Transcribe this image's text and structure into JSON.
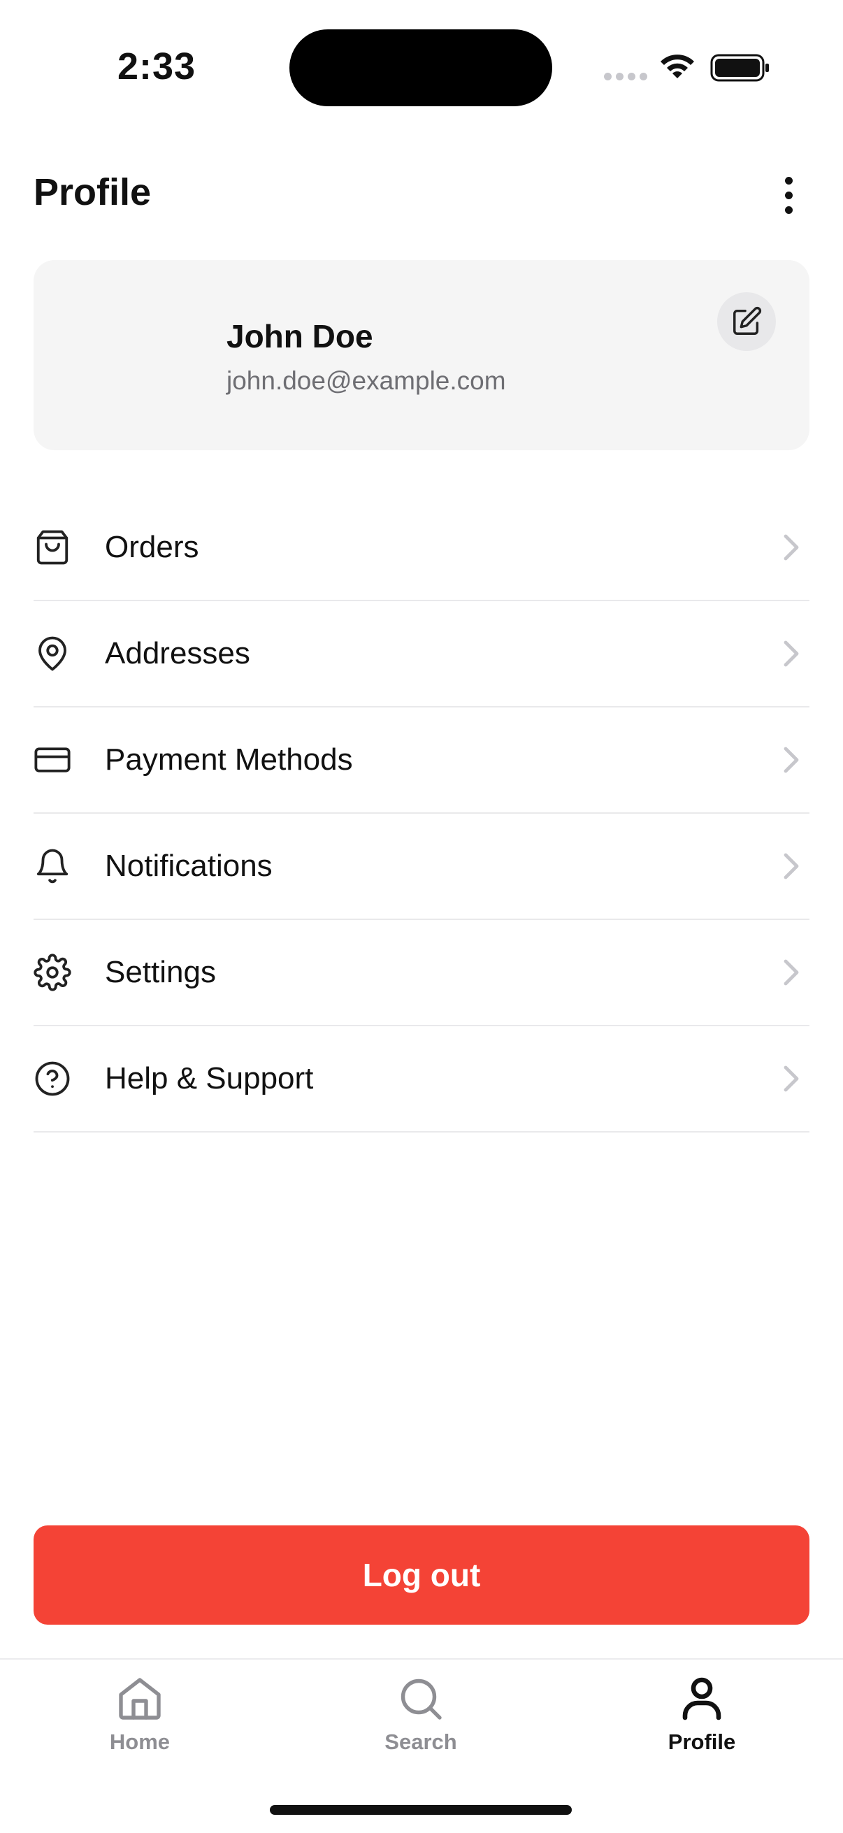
{
  "status_bar": {
    "time": "2:33"
  },
  "header": {
    "title": "Profile"
  },
  "profile": {
    "name": "John Doe",
    "email": "john.doe@example.com"
  },
  "menu": {
    "items": [
      {
        "label": "Orders",
        "icon": "shopping-bag-icon"
      },
      {
        "label": "Addresses",
        "icon": "map-pin-icon"
      },
      {
        "label": "Payment Methods",
        "icon": "credit-card-icon"
      },
      {
        "label": "Notifications",
        "icon": "bell-icon"
      },
      {
        "label": "Settings",
        "icon": "gear-icon"
      },
      {
        "label": "Help & Support",
        "icon": "help-circle-icon"
      }
    ]
  },
  "logout": {
    "label": "Log out",
    "color": "#f44336"
  },
  "tab_bar": {
    "tabs": [
      {
        "label": "Home",
        "icon": "home-icon",
        "active": false
      },
      {
        "label": "Search",
        "icon": "search-icon",
        "active": false
      },
      {
        "label": "Profile",
        "icon": "user-icon",
        "active": true
      }
    ],
    "active_color": "#111111",
    "inactive_color": "#8e8e93"
  }
}
